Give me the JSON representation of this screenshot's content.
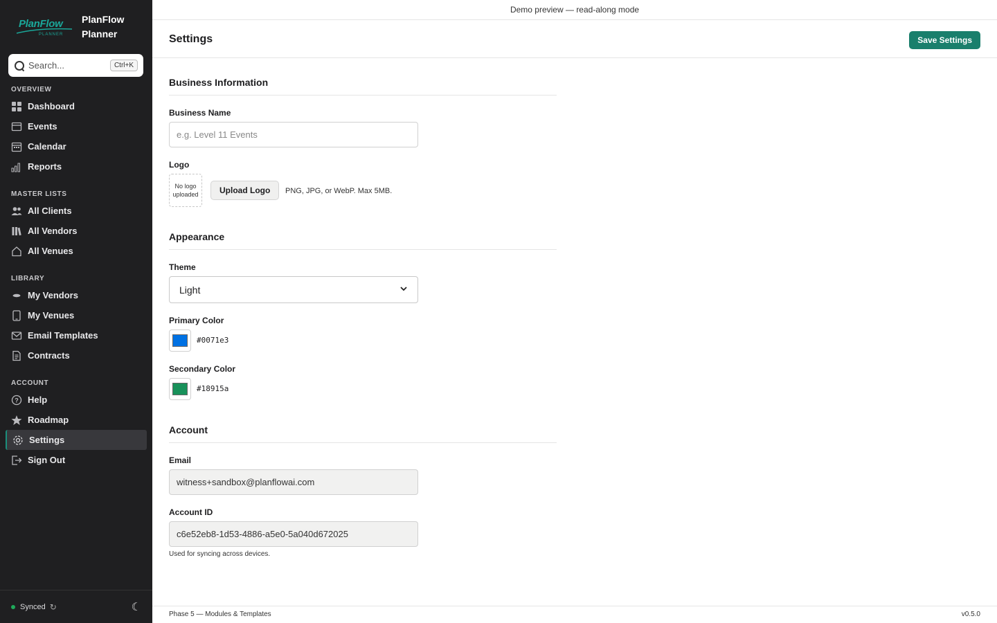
{
  "brand": {
    "logo_text": "PlanFlow",
    "logo_sub": "PLANNER",
    "name": "PlanFlow Planner"
  },
  "search": {
    "placeholder": "Search...",
    "shortcut": "Ctrl+K"
  },
  "nav": {
    "overview": {
      "heading": "OVERVIEW",
      "items": [
        {
          "label": "Dashboard",
          "icon": "grid-icon"
        },
        {
          "label": "Events",
          "icon": "events-icon"
        },
        {
          "label": "Calendar",
          "icon": "calendar-icon"
        },
        {
          "label": "Reports",
          "icon": "chart-icon"
        }
      ]
    },
    "master": {
      "heading": "MASTER LISTS",
      "items": [
        {
          "label": "All Clients",
          "icon": "users-icon"
        },
        {
          "label": "All Vendors",
          "icon": "books-icon"
        },
        {
          "label": "All Venues",
          "icon": "home-icon"
        }
      ]
    },
    "library": {
      "heading": "LIBRARY",
      "items": [
        {
          "label": "My Vendors",
          "icon": "vendor-icon"
        },
        {
          "label": "My Venues",
          "icon": "device-icon"
        },
        {
          "label": "Email Templates",
          "icon": "mail-icon"
        },
        {
          "label": "Contracts",
          "icon": "document-icon"
        }
      ]
    },
    "account": {
      "heading": "ACCOUNT",
      "items": [
        {
          "label": "Help",
          "icon": "help-icon"
        },
        {
          "label": "Roadmap",
          "icon": "star-icon"
        },
        {
          "label": "Settings",
          "icon": "gear-icon",
          "active": true
        },
        {
          "label": "Sign Out",
          "icon": "signout-icon"
        }
      ]
    }
  },
  "sync": {
    "status": "Synced"
  },
  "topbar": {
    "text": "Demo preview — read-along mode"
  },
  "header": {
    "title": "Settings",
    "save_label": "Save Settings"
  },
  "business": {
    "title": "Business Information",
    "name_label": "Business Name",
    "name_placeholder": "e.g. Level 11 Events",
    "logo_label": "Logo",
    "logo_empty": "No logo uploaded",
    "upload_label": "Upload Logo",
    "upload_hint": "PNG, JPG, or WebP. Max 5MB."
  },
  "appearance": {
    "title": "Appearance",
    "theme_label": "Theme",
    "theme_value": "Light",
    "primary_label": "Primary Color",
    "primary_value": "#0071e3",
    "secondary_label": "Secondary Color",
    "secondary_value": "#18915a"
  },
  "account": {
    "title": "Account",
    "email_label": "Email",
    "email_value": "witness+sandbox@planflowai.com",
    "id_label": "Account ID",
    "id_value": "c6e52eb8-1d53-4886-a5e0-5a040d672025",
    "id_hint": "Used for syncing across devices."
  },
  "footer": {
    "left": "Phase 5 — Modules & Templates",
    "right": "v0.5.0"
  },
  "colors": {
    "accent": "#1a7f6c",
    "sidebar_bg": "#1f1f21"
  }
}
